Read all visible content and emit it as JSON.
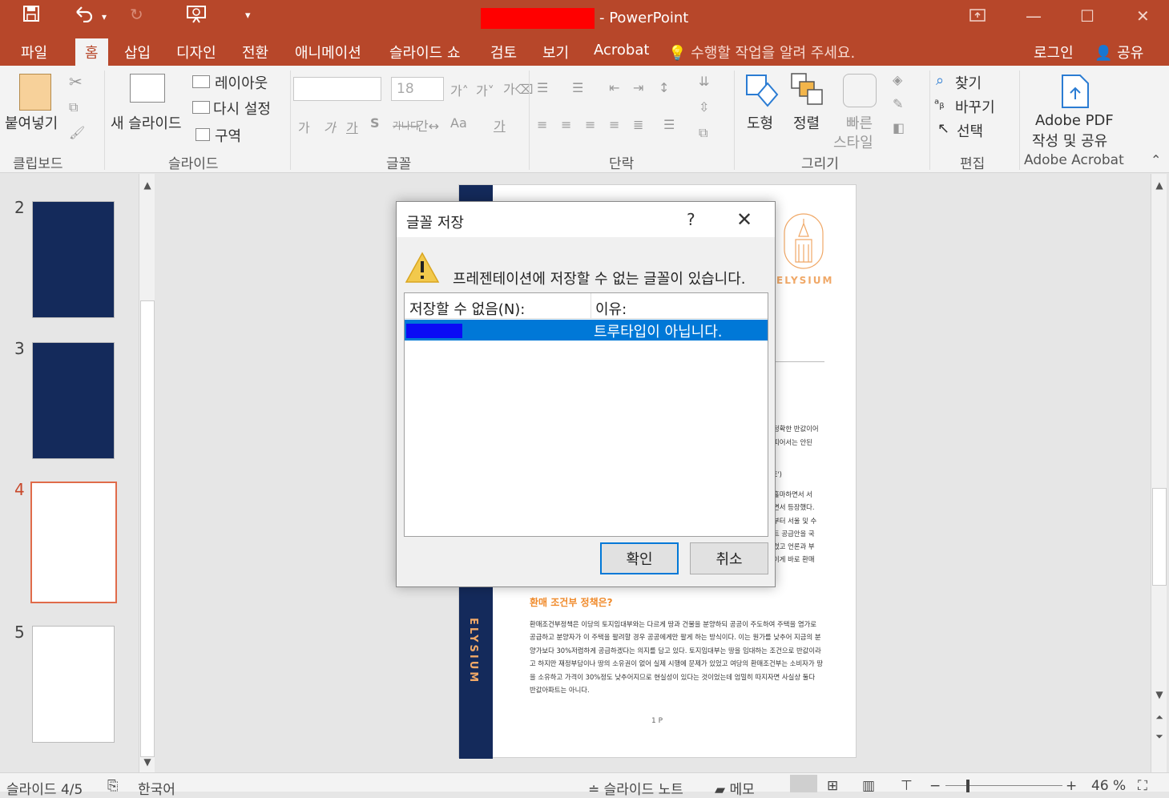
{
  "titlebar": {
    "app_title": "- PowerPoint"
  },
  "tabs": [
    "파일",
    "홈",
    "삽입",
    "디자인",
    "전환",
    "애니메이션",
    "슬라이드 쇼",
    "검토",
    "보기",
    "Acrobat"
  ],
  "tell_me": "수행할 작업을 알려 주세요.",
  "account": {
    "login": "로그인",
    "share": "공유"
  },
  "ribbon": {
    "clipboard": {
      "paste": "붙여넣기",
      "label": "클립보드"
    },
    "slides": {
      "new_slide": "새 슬라이드",
      "layout": "레이아웃",
      "reset": "다시 설정",
      "section": "구역",
      "label": "슬라이드"
    },
    "font": {
      "size": "18",
      "label": "글꼴"
    },
    "paragraph": {
      "label": "단락"
    },
    "drawing": {
      "shapes": "도형",
      "arrange": "정렬",
      "quick_styles_1": "빠른",
      "quick_styles_2": "스타일",
      "label": "그리기"
    },
    "editing": {
      "find": "찾기",
      "replace": "바꾸기",
      "select": "선택",
      "label": "편집"
    },
    "acrobat": {
      "create_1": "Adobe PDF",
      "create_2": "작성 및 공유",
      "label": "Adobe Acrobat"
    }
  },
  "thumbnails": {
    "numbers": [
      "2",
      "3",
      "4",
      "5"
    ]
  },
  "slide": {
    "brand": "ELYSIUM",
    "heading": "환매 조건부 정책은?",
    "paragraph": "환매조건부정책은 이당의 토지임대부와는 다르게 땅과 건물을 분양하되 공공이 주도하여 주택을 염가로 공급하고 분양자가 이 주택을 팔려할 경우 공공에게만 팔게 하는 방식이다. 이는 원가를 낮추어 지금의 분양가보다 30%저렴하게 공급하겠다는 의지를 담고 있다. 토지임대부는 땅을 임대하는 조건으로 반값이라고 하지만 재정부담이나 땅의 소유권이 없어 실제 시행에 문제가 있었고 여당의 환매조건부는 소비자가 땅을 소유하고 가격이 30%정도 낮추어지므로 현실성이 있다는 것이었는데 엄밀히 따지자면 사실상 둘다 반값아파트는 아니다.",
    "page_number": "1 P",
    "fragments": [
      "정확한 반값이어",
      "피어서는 안된",
      "E')",
      "홀마하면서 서",
      "면서 등장했다.",
      "부터 서울 및 수",
      "트 공급안을 국",
      "렸고 언론과 부",
      "이게 바로 환매"
    ]
  },
  "dialog": {
    "title": "글꼴 저장",
    "help": "?",
    "message": "프레젠테이션에 저장할 수 없는 글꼴이 있습니다.",
    "col_cannot_save": "저장할 수 없음(N):",
    "col_reason": "이유:",
    "row_reason": "트루타입이 아닙니다.",
    "ok": "확인",
    "cancel": "취소"
  },
  "status": {
    "slide": "슬라이드 4/5",
    "language": "한국어",
    "notes": "슬라이드 노트",
    "comments": "메모",
    "zoom": "46 %"
  },
  "colors": {
    "accent": "#b7472a",
    "slide_navy": "#142a5b",
    "slide_orange": "#f0a867",
    "selection": "#0078d7"
  }
}
